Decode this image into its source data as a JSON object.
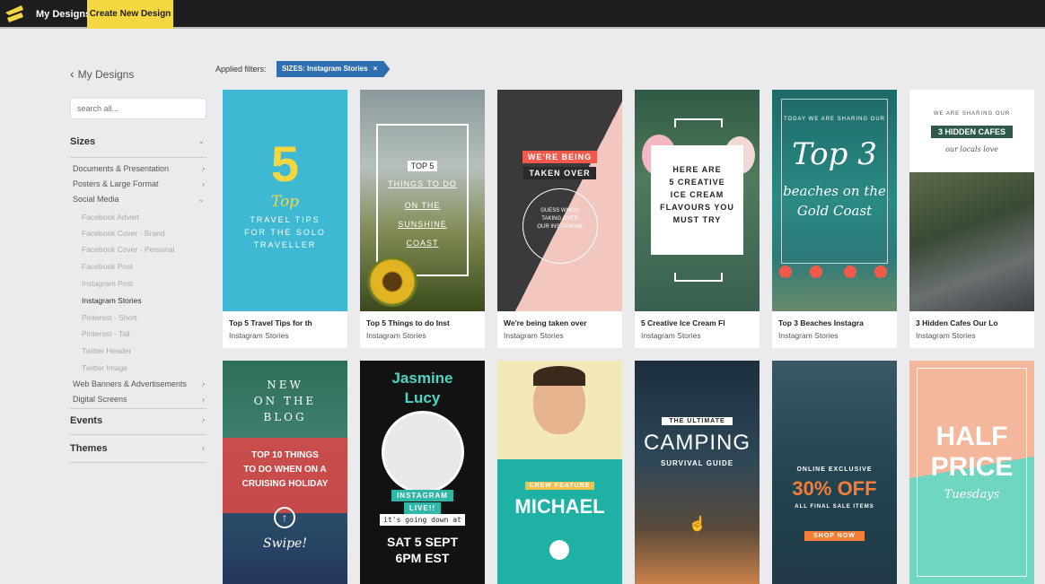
{
  "topbar": {
    "my_designs": "My Designs",
    "create": "Create New Design"
  },
  "sidebar": {
    "back": "My Designs",
    "search_placeholder": "search all...",
    "sizes": "Sizes",
    "items": [
      "Documents & Presentation",
      "Posters & Large Format",
      "Social Media",
      "Web Banners & Advertisements",
      "Digital Screens"
    ],
    "social": [
      "Facebook Advert",
      "Facebook Cover - Brand",
      "Facebook Cover - Personal",
      "Facebook Post",
      "Instagram Post",
      "Instagram Stories",
      "Pinterest - Short",
      "Pinterest - Tall",
      "Twitter Header",
      "Twitter Image"
    ],
    "events": "Events",
    "themes": "Themes"
  },
  "filters": {
    "label": "Applied filters:",
    "chip": "SIZES: Instagram Stories",
    "remove": "×"
  },
  "cards": [
    {
      "title": "Top 5 Travel Tips for th",
      "sub": "Instagram Stories",
      "t1": "5",
      "t2": "Top",
      "t3": "TRAVEL TIPS",
      "t4": "FOR THE SOLO",
      "t5": "TRAVELLER"
    },
    {
      "title": "Top 5 Things to do Inst",
      "sub": "Instagram Stories",
      "t1": "TOP 5",
      "t2": "THINGS TO DO",
      "t3": "ON THE",
      "t4": "SUNSHINE",
      "t5": "COAST"
    },
    {
      "title": "We're being taken over",
      "sub": "Instagram Stories",
      "t1": "WE'RE BEING",
      "t2": "TAKEN OVER",
      "t3": "GUESS WHO'S",
      "t4": "TAKING OVER",
      "t5": "OUR INSTAGRAM"
    },
    {
      "title": "5 Creative Ice Cream Fl",
      "sub": "Instagram Stories",
      "t1": "HERE ARE",
      "t2": "5 CREATIVE",
      "t3": "ICE CREAM",
      "t4": "FLAVOURS YOU",
      "t5": "MUST TRY"
    },
    {
      "title": "Top 3 Beaches Instagra",
      "sub": "Instagram Stories",
      "t1": "TODAY WE ARE SHARING OUR",
      "t2": "Top 3",
      "t3": "beaches on the",
      "t4": "Gold Coast"
    },
    {
      "title": "3 Hidden Cafes Our Lo",
      "sub": "Instagram Stories",
      "t1": "WE ARE SHARING OUR",
      "t2": "3 HIDDEN CAFES",
      "t3": "our locals love"
    },
    {
      "t1": "NEW",
      "t2": "ON THE",
      "t3": "BLOG",
      "t4": "TOP 10 THINGS",
      "t5": "TO DO WHEN ON A",
      "t6": "CRUISING HOLIDAY",
      "t7": "Swipe!"
    },
    {
      "t1": "Jasmine",
      "t2": "Lucy",
      "t3": "INSTAGRAM",
      "t4": "LIVE!!",
      "t5": "it's going down at",
      "t6": "SAT 5 SEPT",
      "t7": "6PM EST"
    },
    {
      "t1": "CREW FEATURE",
      "t2": "MICHAEL"
    },
    {
      "t1": "THE ULTIMATE",
      "t2": "CAMPING",
      "t3": "SURVIVAL GUIDE"
    },
    {
      "t1": "ONLINE EXCLUSIVE",
      "t2": "30% OFF",
      "t3": "ALL FINAL SALE ITEMS",
      "t4": "SHOP NOW"
    },
    {
      "t1": "HALF",
      "t2": "PRICE",
      "t3": "Tuesdays"
    }
  ],
  "colors": {
    "accent": "#f5d742",
    "chip": "#2f6fb1",
    "topbar": "#1e1e1e"
  }
}
